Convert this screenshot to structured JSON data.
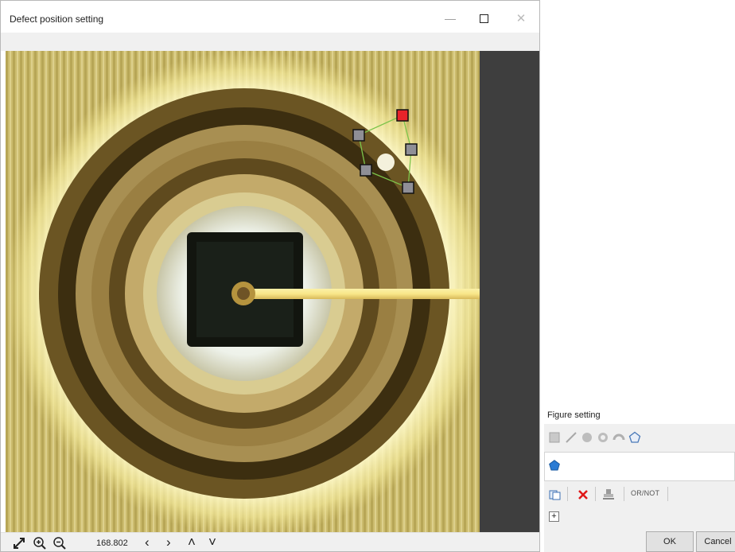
{
  "window": {
    "title": "Defect position setting",
    "min_glyph": "—",
    "close_glyph": "✕"
  },
  "toolbar": {
    "zoom_value": "168.802",
    "nav_left": "‹",
    "nav_right": "›",
    "nav_up": "˄",
    "nav_down": "˅"
  },
  "viewer": {
    "selected_vertex_color": "#e8232a",
    "vertex_color": "#8f8f96",
    "polygon_line_color": "#7cc44a"
  },
  "figure_setting": {
    "title": "Figure setting",
    "or_not_label": "OR/NOT",
    "expand_glyph": "+",
    "ok_label": "OK",
    "cancel_label": "Cancel"
  },
  "icons": {
    "fit": "fit-view-icon",
    "zoom_in": "zoom-in-icon",
    "zoom_out": "zoom-out-icon",
    "rectangle": "rectangle-shape-icon",
    "line": "line-shape-icon",
    "circle": "circle-shape-icon",
    "ring": "ring-shape-icon",
    "arc": "arc-shape-icon",
    "polygon": "polygon-shape-icon",
    "copy": "copy-icon",
    "delete": "delete-icon",
    "stamp": "stamp-icon"
  }
}
